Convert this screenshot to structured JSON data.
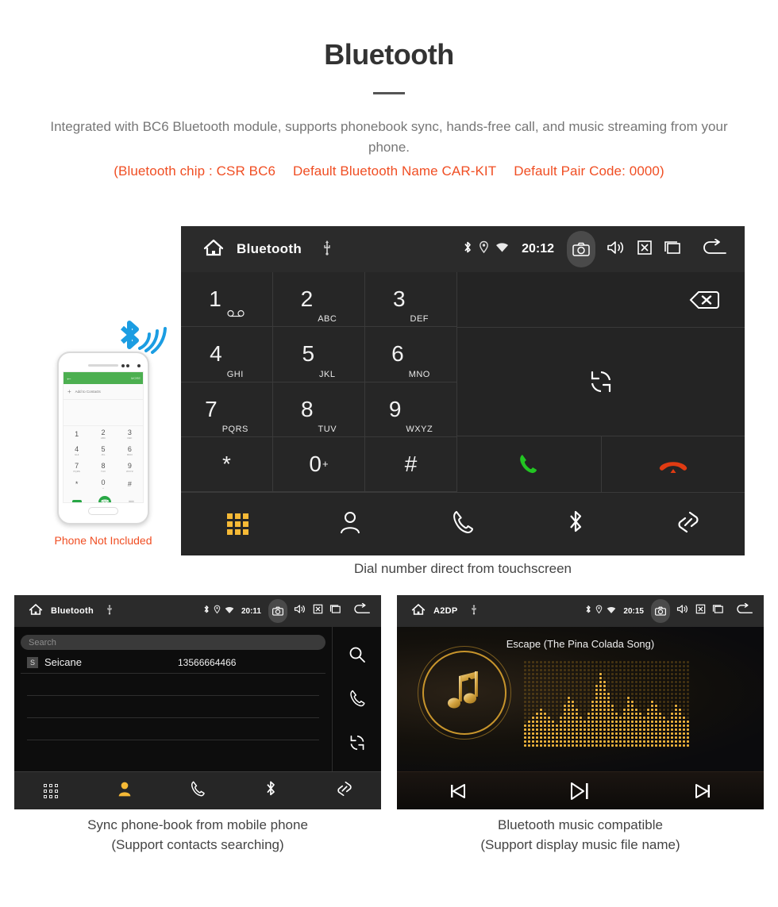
{
  "header": {
    "title": "Bluetooth",
    "description": "Integrated with BC6 Bluetooth module, supports phonebook sync, hands-free call, and music streaming from your phone.",
    "spec_chip": "(Bluetooth chip : CSR BC6",
    "spec_name": "Default Bluetooth Name CAR-KIT",
    "spec_pair": "Default Pair Code: 0000)"
  },
  "phone_mockup": {
    "note": "Phone Not Included",
    "app_more": "MORE",
    "add_to_contacts": "Add to Contacts",
    "keys": [
      {
        "num": "1",
        "sub": ""
      },
      {
        "num": "2",
        "sub": "ABC"
      },
      {
        "num": "3",
        "sub": "DEF"
      },
      {
        "num": "4",
        "sub": "GHI"
      },
      {
        "num": "5",
        "sub": "JKL"
      },
      {
        "num": "6",
        "sub": "MNO"
      },
      {
        "num": "7",
        "sub": "PQRS"
      },
      {
        "num": "8",
        "sub": "TUV"
      },
      {
        "num": "9",
        "sub": "WXYZ"
      },
      {
        "num": "*",
        "sub": ""
      },
      {
        "num": "0",
        "sub": "+"
      },
      {
        "num": "#",
        "sub": ""
      }
    ]
  },
  "dialer_screen": {
    "statusbar": {
      "title": "Bluetooth",
      "clock": "20:12",
      "icons": [
        "home-icon",
        "usb-icon",
        "bluetooth-icon",
        "location-icon",
        "wifi-icon",
        "camera-icon",
        "volume-icon",
        "close-box-icon",
        "recents-icon",
        "back-icon"
      ]
    },
    "keys": [
      {
        "num": "1",
        "sub": ""
      },
      {
        "num": "2",
        "sub": "ABC"
      },
      {
        "num": "3",
        "sub": "DEF"
      },
      {
        "num": "4",
        "sub": "GHI"
      },
      {
        "num": "5",
        "sub": "JKL"
      },
      {
        "num": "6",
        "sub": "MNO"
      },
      {
        "num": "7",
        "sub": "PQRS"
      },
      {
        "num": "8",
        "sub": "TUV"
      },
      {
        "num": "9",
        "sub": "WXYZ"
      },
      {
        "num": "*",
        "sub": ""
      },
      {
        "num": "0",
        "sub": "+"
      },
      {
        "num": "#",
        "sub": ""
      }
    ],
    "actions": [
      "backspace-icon",
      "sync-icon",
      "call-icon",
      "hangup-icon"
    ],
    "tabs": [
      "dialpad-tab",
      "contacts-tab",
      "calls-tab",
      "bluetooth-tab",
      "link-tab"
    ],
    "active_tab": "dialpad-tab",
    "caption": "Dial number direct from touchscreen"
  },
  "contacts_screen": {
    "statusbar": {
      "title": "Bluetooth",
      "clock": "20:11"
    },
    "search_placeholder": "Search",
    "contacts": [
      {
        "initial": "S",
        "name": "Seicane",
        "number": "13566664466"
      }
    ],
    "side_actions": [
      "search-icon",
      "call-icon",
      "sync-icon"
    ],
    "tabs": [
      "dialpad-tab",
      "contacts-tab",
      "calls-tab",
      "bluetooth-tab",
      "link-tab"
    ],
    "active_tab": "contacts-tab",
    "caption_line1": "Sync phone-book from mobile phone",
    "caption_line2": "(Support contacts searching)"
  },
  "music_screen": {
    "statusbar": {
      "title": "A2DP",
      "clock": "20:15"
    },
    "song_title": "Escape (The Pina Colada Song)",
    "controls": [
      "previous-icon",
      "play-pause-icon",
      "next-icon"
    ],
    "caption_line1": "Bluetooth music compatible",
    "caption_line2": "(Support display music file name)"
  },
  "colors": {
    "accent_orange": "#f04e23",
    "active_tab": "#f5b936",
    "call_green": "#22c522",
    "hangup_red": "#e03b12",
    "screen_bg": "#262626",
    "statusbar_bg": "#2b2b2b"
  }
}
